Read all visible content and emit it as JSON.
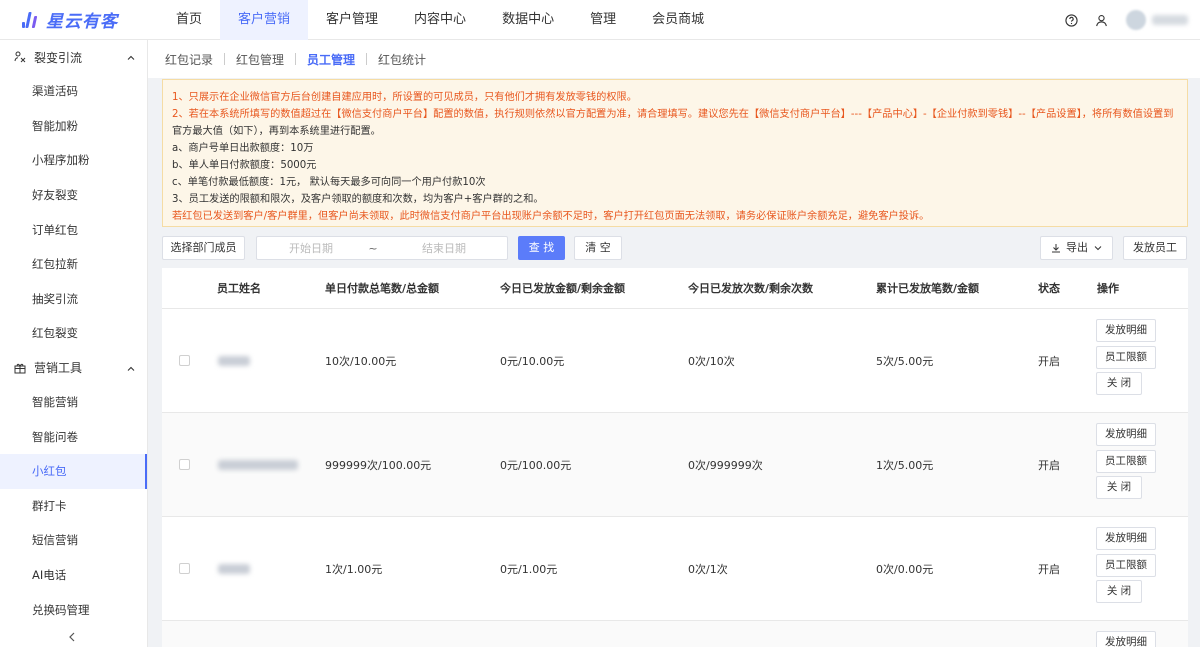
{
  "app": {
    "logo_text": "星云有客"
  },
  "nav": [
    {
      "label": "首页"
    },
    {
      "label": "客户营销",
      "active": true
    },
    {
      "label": "客户管理"
    },
    {
      "label": "内容中心"
    },
    {
      "label": "数据中心"
    },
    {
      "label": "管理"
    },
    {
      "label": "会员商城"
    }
  ],
  "sidebar": {
    "group1": {
      "label": "裂变引流",
      "icon": "fission-icon"
    },
    "group1_items": [
      "渠道活码",
      "智能加粉",
      "小程序加粉",
      "好友裂变",
      "订单红包",
      "红包拉新",
      "抽奖引流",
      "红包裂变"
    ],
    "group2": {
      "label": "营销工具",
      "icon": "gift-icon"
    },
    "group2_items": [
      "智能营销",
      "智能问卷",
      "小红包",
      "群打卡",
      "短信营销",
      "AI电话",
      "兑换码管理"
    ],
    "active_item": "小红包"
  },
  "tabs": [
    "红包记录",
    "红包管理",
    "员工管理",
    "红包统计"
  ],
  "active_tab": "员工管理",
  "notice": {
    "line1": "1、只展示在企业微信官方后台创建自建应用时，所设置的可见成员，只有他们才拥有发放零钱的权限。",
    "line2": "2、若在本系统所填写的数值超过在【微信支付商户平台】配置的数值，执行规则依然以官方配置为准，请合理填写。建议您先在【微信支付商户平台】---【产品中心】-【企业付款到零钱】--【产品设置】，将所有数值设置到",
    "line3": "官方最大值（如下），再到本系统里进行配置。",
    "line4": "a、商户号单日出款额度：10万",
    "line5": "b、单人单日付款额度：5000元",
    "line6": "c、单笔付款最低额度：1元， 默认每天最多可向同一个用户付款10次",
    "line7": "3、员工发送的限额和限次，及客户领取的额度和次数，均为客户+客户群的之和。",
    "line8": "若红包已发送到客户/客户群里，但客户尚未领取，此时微信支付商户平台出现账户余额不足时，客户打开红包页面无法领取，请务必保证账户余额充足，避免客户投诉。"
  },
  "toolbar": {
    "select_dept": "选择部门成员",
    "start_placeholder": "开始日期",
    "range_sep": "~",
    "end_placeholder": "结束日期",
    "search": "查 找",
    "clear": "清 空",
    "export": "导出",
    "issue_staff": "发放员工"
  },
  "table": {
    "headers": [
      "员工姓名",
      "单日付款总笔数/总金额",
      "今日已发放金额/剩余金额",
      "今日已发放次数/剩余次数",
      "累计已发放笔数/金额",
      "状态",
      "操作"
    ],
    "rows": [
      {
        "daily": "10次/10.00元",
        "today_amount": "0元/10.00元",
        "today_count": "0次/10次",
        "total": "5次/5.00元",
        "status": "开启"
      },
      {
        "daily": "999999次/100.00元",
        "today_amount": "0元/100.00元",
        "today_count": "0次/999999次",
        "total": "1次/5.00元",
        "status": "开启"
      },
      {
        "daily": "1次/1.00元",
        "today_amount": "0元/1.00元",
        "today_count": "0次/1次",
        "total": "0次/0.00元",
        "status": "开启"
      }
    ],
    "ops": {
      "detail": "发放明细",
      "limit": "员工限额",
      "close": "关 闭"
    }
  },
  "colors": {
    "accent": "#4a6cf7",
    "notice_bg": "#fdf6e8",
    "notice_red": "#e8571e"
  }
}
